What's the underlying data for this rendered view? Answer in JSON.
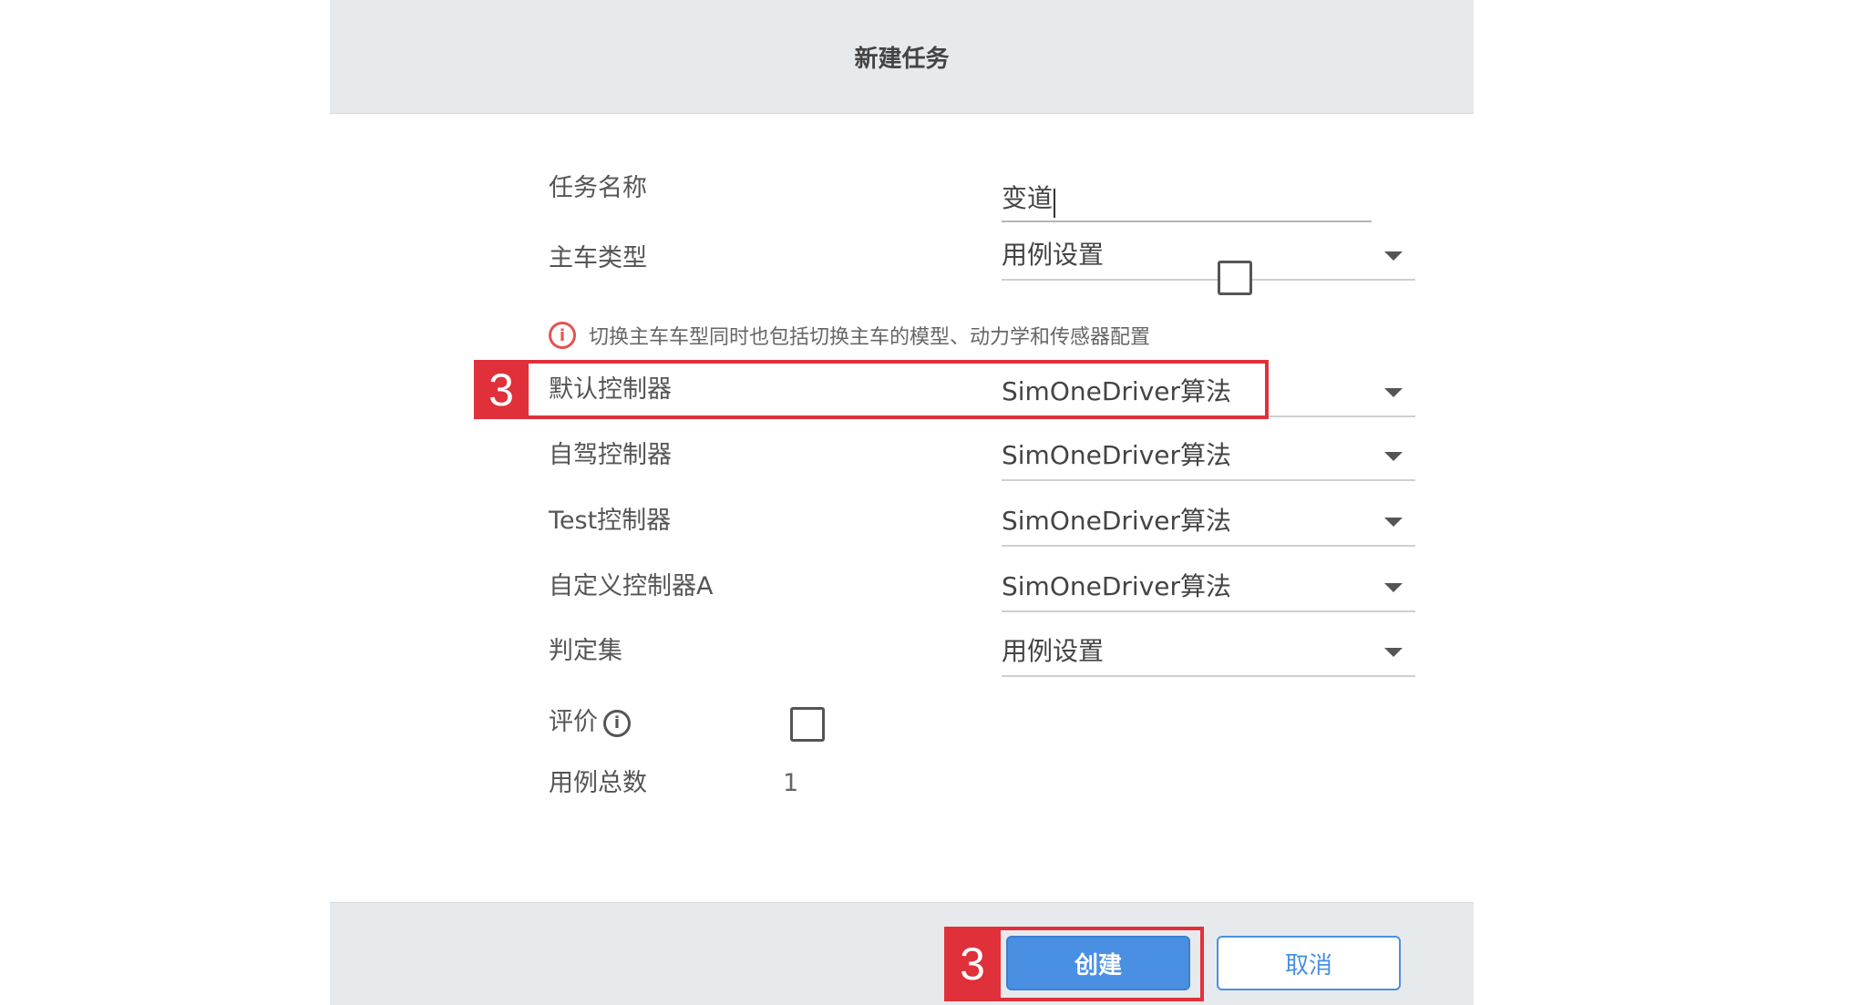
{
  "dialog": {
    "title": "新建任务",
    "task_name": {
      "label": "任务名称",
      "value": "变道"
    },
    "ego_type": {
      "label": "主车类型",
      "value": "用例设置"
    },
    "hint": "切换主车车型同时也包括切换主车的模型、动力学和传感器配置",
    "default_controller": {
      "label": "默认控制器",
      "value": "SimOneDriver算法"
    },
    "autodrive_controller": {
      "label": "自驾控制器",
      "value": "SimOneDriver算法"
    },
    "test_controller": {
      "label": "Test控制器",
      "value": "SimOneDriver算法"
    },
    "custom_controller": {
      "label": "自定义控制器A",
      "value": "SimOneDriver算法"
    },
    "judge_set": {
      "label": "判定集",
      "value": "用例设置"
    },
    "evaluation": {
      "label": "评价"
    },
    "case_total": {
      "label": "用例总数",
      "value": "1"
    },
    "create_label": "创建",
    "cancel_label": "取消"
  },
  "callouts": {
    "controller_step": "3",
    "create_step": "3"
  },
  "colors": {
    "primary": "#4a90e2",
    "callout": "#e0303a",
    "warning": "#e0554f",
    "header_bg": "#e7eaed"
  }
}
